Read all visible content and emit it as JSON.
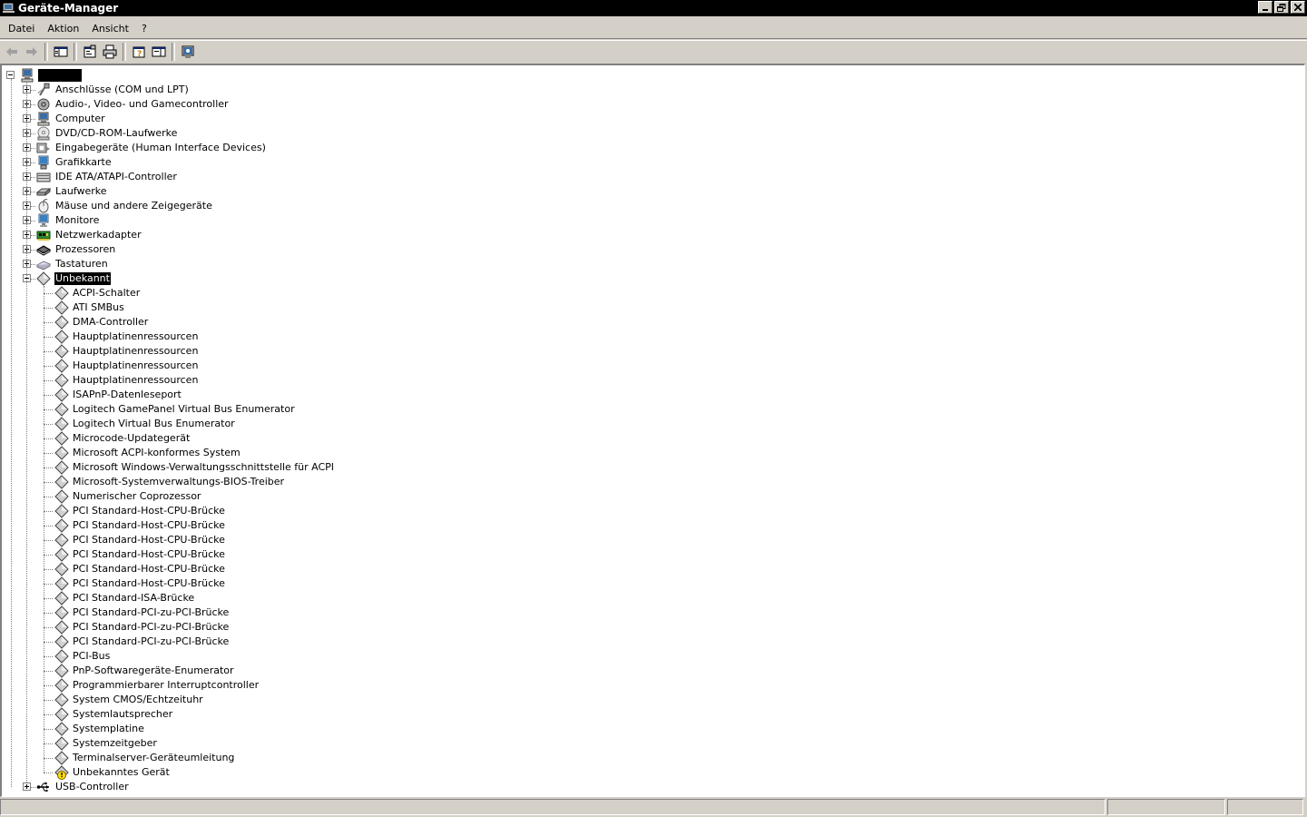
{
  "window": {
    "title": "Geräte-Manager",
    "controls": [
      "minimize",
      "restore",
      "close"
    ]
  },
  "menu": [
    "Datei",
    "Aktion",
    "Ansicht",
    "?"
  ],
  "toolbar": {
    "buttons": [
      "back-arrow-icon",
      "forward-arrow-icon",
      "show-hide-console-tree-icon",
      "properties-icon",
      "print-icon",
      "help-icon",
      "show-action-pane-icon",
      "scan-hardware-icon"
    ]
  },
  "tree": {
    "root": {
      "label": "",
      "icon": "computer-icon",
      "expanded": true
    },
    "categories": [
      {
        "label": "Anschlüsse (COM und LPT)",
        "icon": "port-icon"
      },
      {
        "label": "Audio-, Video- und Gamecontroller",
        "icon": "speaker-icon"
      },
      {
        "label": "Computer",
        "icon": "computer-icon"
      },
      {
        "label": "DVD/CD-ROM-Laufwerke",
        "icon": "cdrom-icon"
      },
      {
        "label": "Eingabegeräte (Human Interface Devices)",
        "icon": "hid-icon"
      },
      {
        "label": "Grafikkarte",
        "icon": "display-adapter-icon"
      },
      {
        "label": "IDE ATA/ATAPI-Controller",
        "icon": "ide-controller-icon"
      },
      {
        "label": "Laufwerke",
        "icon": "disk-drive-icon"
      },
      {
        "label": "Mäuse und andere Zeigegeräte",
        "icon": "mouse-icon"
      },
      {
        "label": "Monitore",
        "icon": "monitor-icon"
      },
      {
        "label": "Netzwerkadapter",
        "icon": "network-adapter-icon"
      },
      {
        "label": "Prozessoren",
        "icon": "processor-icon"
      },
      {
        "label": "Tastaturen",
        "icon": "keyboard-icon"
      }
    ],
    "expanded_category": {
      "label": "Unbekannt",
      "icon": "unknown-device-icon",
      "selected": true
    },
    "children": [
      "ACPI-Schalter",
      "ATI SMBus",
      "DMA-Controller",
      "Hauptplatinenressourcen",
      "Hauptplatinenressourcen",
      "Hauptplatinenressourcen",
      "Hauptplatinenressourcen",
      "ISAPnP-Datenleseport",
      "Logitech GamePanel Virtual Bus Enumerator",
      "Logitech Virtual Bus Enumerator",
      "Microcode-Updategerät",
      "Microsoft ACPI-konformes System",
      "Microsoft Windows-Verwaltungsschnittstelle für ACPI",
      "Microsoft-Systemverwaltungs-BIOS-Treiber",
      "Numerischer Coprozessor",
      "PCI Standard-Host-CPU-Brücke",
      "PCI Standard-Host-CPU-Brücke",
      "PCI Standard-Host-CPU-Brücke",
      "PCI Standard-Host-CPU-Brücke",
      "PCI Standard-Host-CPU-Brücke",
      "PCI Standard-Host-CPU-Brücke",
      "PCI Standard-ISA-Brücke",
      "PCI Standard-PCI-zu-PCI-Brücke",
      "PCI Standard-PCI-zu-PCI-Brücke",
      "PCI Standard-PCI-zu-PCI-Brücke",
      "PCI-Bus",
      "PnP-Softwaregeräte-Enumerator",
      "Programmierbarer Interruptcontroller",
      "System CMOS/Echtzeituhr",
      "Systemlautsprecher",
      "Systemplatine",
      "Systemzeitgeber",
      "Terminalserver-Geräteumleitung",
      "Unbekanntes Gerät"
    ],
    "warning_child": "Unbekanntes Gerät",
    "last_category": {
      "label": "USB-Controller",
      "icon": "usb-icon"
    }
  },
  "statusbar": {
    "panes": [
      "",
      "",
      ""
    ]
  }
}
